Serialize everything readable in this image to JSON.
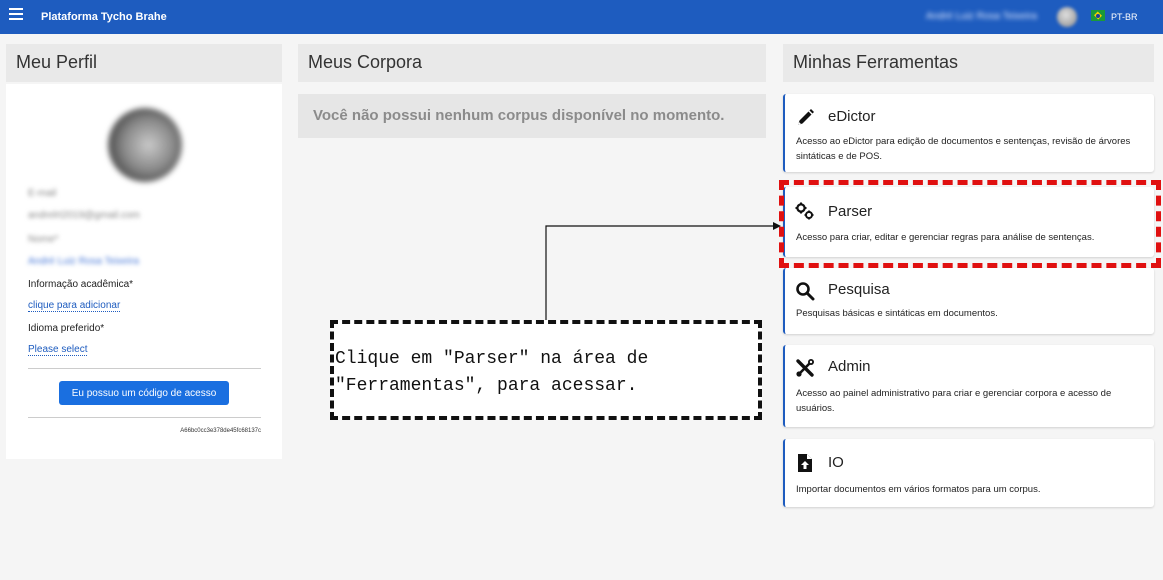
{
  "topbar": {
    "app_title": "Plataforma Tycho Brahe",
    "user_name": "André Luiz Rosa Teixeira",
    "language": "PT-BR",
    "icons": {
      "menu": "hamburger-menu-icon",
      "flag": "brazil-flag-icon"
    },
    "color": "#1e5cbf"
  },
  "profile": {
    "title": "Meu Perfil",
    "email_label": "E-mail",
    "email_value": "andrelrt2019@gmail.com",
    "name_label": "Nome*",
    "name_value": "André Luiz Rosa Teixeira",
    "academic_label": "Informação acadêmica*",
    "academic_link": "clique para adicionar",
    "language_label": "Idioma preferido*",
    "language_link": "Please select",
    "access_code_button": "Eu possuo um código de acesso",
    "user_hash": "A66bc0cc3e378de45fc68137c"
  },
  "corpora": {
    "title": "Meus Corpora",
    "empty_message": "Você não possui nenhum corpus disponível no momento."
  },
  "tools": {
    "title": "Minhas Ferramentas",
    "items": [
      {
        "name": "eDictor",
        "icon": "pencil-icon",
        "desc": "Acesso ao eDictor para edição de documentos e sentenças, revisão de árvores sintáticas e de POS."
      },
      {
        "name": "Parser",
        "icon": "gears-icon",
        "desc": "Acesso para criar, editar e gerenciar regras para análise de sentenças."
      },
      {
        "name": "Pesquisa",
        "icon": "search-icon",
        "desc": "Pesquisas básicas e sintáticas em documentos."
      },
      {
        "name": "Admin",
        "icon": "tools-icon",
        "desc": "Acesso ao painel administrativo para criar e gerenciar corpora e acesso de usuários."
      },
      {
        "name": "IO",
        "icon": "file-upload-icon",
        "desc": "Importar documentos em vários formatos para um corpus."
      }
    ]
  },
  "annotation": {
    "line1": "Clique em \"Parser\" na área de",
    "line2": "\"Ferramentas\", para acessar.",
    "highlight_color": "#e01010"
  }
}
